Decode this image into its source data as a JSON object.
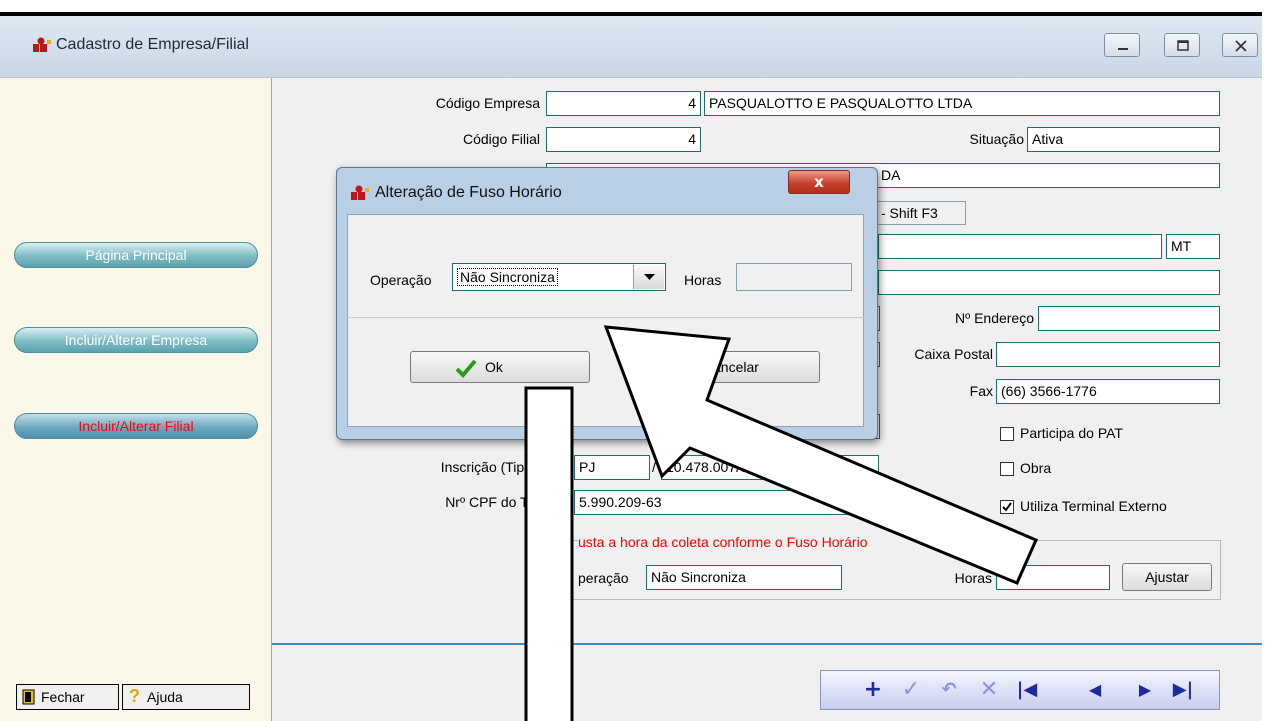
{
  "window": {
    "title": "Cadastro de Empresa/Filial",
    "controls": [
      "minimize-icon",
      "maximize-icon",
      "close-icon"
    ]
  },
  "sidebar": {
    "items": [
      {
        "label": "Página Principal",
        "active": false
      },
      {
        "label": "Incluir/Alterar Empresa",
        "active": false
      },
      {
        "label": "Incluir/Alterar Filial",
        "active": true
      }
    ],
    "close_label": "Fechar",
    "help_label": "Ajuda"
  },
  "form": {
    "codigo_empresa_label": "Código Empresa",
    "codigo_empresa": "4",
    "empresa_nome": "PASQUALOTTO E PASQUALOTTO LTDA",
    "codigo_filial_label": "Código Filial",
    "codigo_filial": "4",
    "situacao_label": "Situação",
    "situacao": "Ativa",
    "nome_filial_partial": "DA",
    "shortcut_partial": "- Shift F3",
    "uf": "MT",
    "numero_endereco_label": "Nº Endereço",
    "numero_endereco": "",
    "caixa_postal_label": "Caixa Postal",
    "caixa_postal": "",
    "fax_label": "Fax",
    "fax": "(66) 3566-1776",
    "participa_pat_label": "Participa do PAT",
    "participa_pat": false,
    "obra_label": "Obra",
    "obra": false,
    "terminal_externo_label": "Utiliza Terminal Externo",
    "terminal_externo": true,
    "inscricao_label_partial": "Inscrição (Tipo/N",
    "inscricao_tipo_partial": "PJ",
    "inscricao_sep": "/",
    "inscricao_numero_partial": "10.478.007/0001-7",
    "cpf_label_partial": "Nrº CPF do Titul",
    "cpf_partial": "5.990.209-63",
    "fuso_note_partial": "usta a hora da coleta conforme o Fuso Horário",
    "operacao_label_partial": "peração",
    "operacao": "Não Sincroniza",
    "horas_label": "Horas",
    "horas": "",
    "ajustar_label": "Ajustar"
  },
  "dialog": {
    "title": "Alteração de Fuso Horário",
    "operacao_label": "Operação",
    "operacao_value": "Não Sincroniza",
    "horas_label": "Horas",
    "horas_value": "",
    "ok_label": "Ok",
    "cancel_label_partial": "ancelar",
    "close_symbol": "x"
  },
  "navbar": {
    "icons": [
      "add-icon",
      "confirm-icon",
      "undo-icon",
      "delete-icon",
      "first-icon",
      "prev-icon",
      "next-icon",
      "last-icon"
    ]
  },
  "colors": {
    "field_border": "#1c6e6a",
    "note_red": "#ff0000",
    "sidebar_bg": "#fbf8ea",
    "nav_blue": "#1e2aa0",
    "separator": "#3c8cc0"
  }
}
